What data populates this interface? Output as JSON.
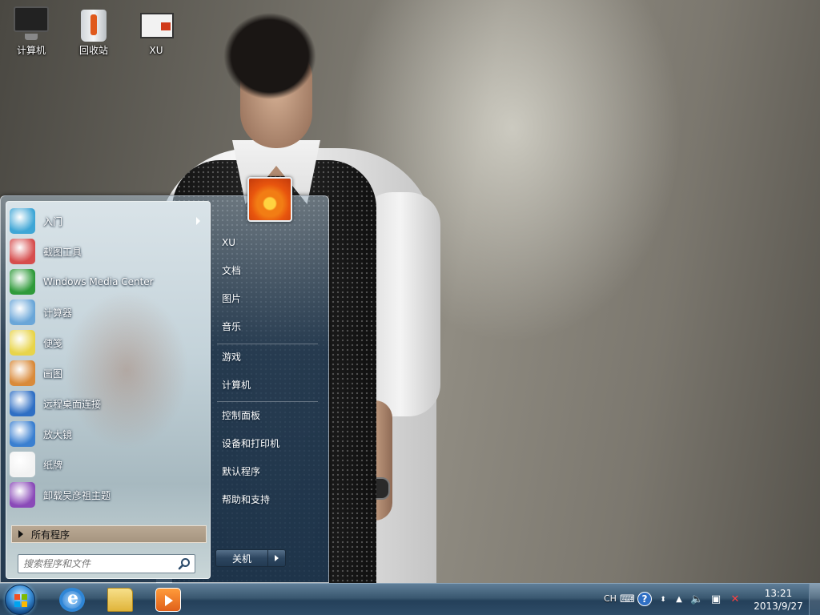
{
  "desktop": {
    "icons": [
      {
        "label": "计算机",
        "icon": "computer-icon"
      },
      {
        "label": "回收站",
        "icon": "recycle-bin-icon"
      },
      {
        "label": "XU",
        "icon": "user-folder-icon"
      }
    ]
  },
  "start_menu": {
    "programs": [
      {
        "label": "入门",
        "icon": "getting-started-icon",
        "color": "#3fa6d6",
        "has_submenu": true
      },
      {
        "label": "截图工具",
        "icon": "snipping-tool-icon",
        "color": "#d64d4d"
      },
      {
        "label": "Windows Media Center",
        "icon": "media-center-icon",
        "color": "#2f9a3a"
      },
      {
        "label": "计算器",
        "icon": "calculator-icon",
        "color": "#6aa6d8"
      },
      {
        "label": "便笺",
        "icon": "sticky-notes-icon",
        "color": "#e8d44a"
      },
      {
        "label": "画图",
        "icon": "paint-icon",
        "color": "#d98a3a"
      },
      {
        "label": "远程桌面连接",
        "icon": "remote-desktop-icon",
        "color": "#2f6fc4"
      },
      {
        "label": "放大镜",
        "icon": "magnifier-icon",
        "color": "#3a7fd0"
      },
      {
        "label": "纸牌",
        "icon": "solitaire-icon",
        "color": "#f2f2f2"
      },
      {
        "label": "卸载吴彦祖主题",
        "icon": "uninstall-theme-icon",
        "color": "#8a4ab8"
      }
    ],
    "all_programs": "所有程序",
    "search_placeholder": "搜索程序和文件",
    "right_items": [
      "XU",
      "文档",
      "图片",
      "音乐",
      "游戏",
      "计算机",
      "控制面板",
      "设备和打印机",
      "默认程序",
      "帮助和支持"
    ],
    "shutdown": "关机"
  },
  "taskbar": {
    "pinned": [
      {
        "name": "Internet Explorer",
        "icon": "internet-explorer-icon"
      },
      {
        "name": "Windows Explorer",
        "icon": "folder-icon"
      },
      {
        "name": "Windows Media Player",
        "icon": "media-player-icon"
      }
    ],
    "language": "CH",
    "clock_time": "13:21",
    "clock_date": "2013/9/27"
  }
}
